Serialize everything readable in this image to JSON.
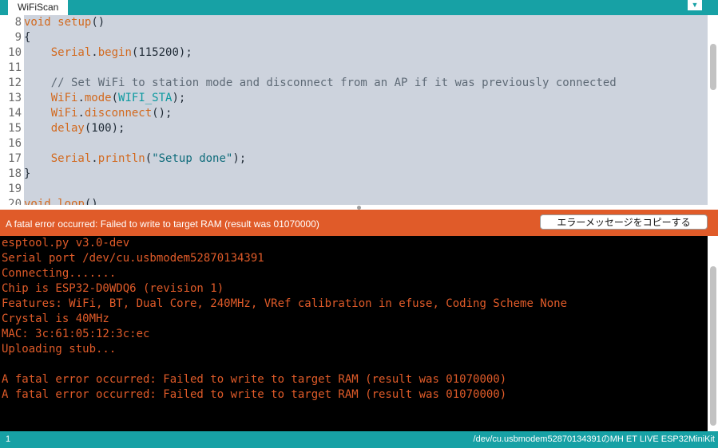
{
  "tabs": [
    {
      "label": "WiFiScan"
    }
  ],
  "tab_menu_icon": "dropdown-arrow-icon",
  "editor": {
    "lines": [
      {
        "num": "8",
        "segments": [
          {
            "t": "void",
            "c": "kw"
          },
          {
            "t": " "
          },
          {
            "t": "setup",
            "c": "fn"
          },
          {
            "t": "()"
          }
        ]
      },
      {
        "num": "9",
        "segments": [
          {
            "t": "{"
          }
        ]
      },
      {
        "num": "10",
        "segments": [
          {
            "t": "    "
          },
          {
            "t": "Serial",
            "c": "kw"
          },
          {
            "t": "."
          },
          {
            "t": "begin",
            "c": "fn"
          },
          {
            "t": "(115200);"
          }
        ]
      },
      {
        "num": "11",
        "segments": [
          {
            "t": ""
          }
        ]
      },
      {
        "num": "12",
        "segments": [
          {
            "t": "    // Set WiFi to station mode and disconnect from an AP if it was previously connected",
            "c": "cmt"
          }
        ]
      },
      {
        "num": "13",
        "segments": [
          {
            "t": "    "
          },
          {
            "t": "WiFi",
            "c": "kw"
          },
          {
            "t": "."
          },
          {
            "t": "mode",
            "c": "fn"
          },
          {
            "t": "("
          },
          {
            "t": "WIFI_STA",
            "c": "const"
          },
          {
            "t": ");"
          }
        ]
      },
      {
        "num": "14",
        "segments": [
          {
            "t": "    "
          },
          {
            "t": "WiFi",
            "c": "kw"
          },
          {
            "t": "."
          },
          {
            "t": "disconnect",
            "c": "fn"
          },
          {
            "t": "();"
          }
        ]
      },
      {
        "num": "15",
        "segments": [
          {
            "t": "    "
          },
          {
            "t": "delay",
            "c": "fn"
          },
          {
            "t": "(100);"
          }
        ]
      },
      {
        "num": "16",
        "segments": [
          {
            "t": ""
          }
        ]
      },
      {
        "num": "17",
        "segments": [
          {
            "t": "    "
          },
          {
            "t": "Serial",
            "c": "kw"
          },
          {
            "t": "."
          },
          {
            "t": "println",
            "c": "fn"
          },
          {
            "t": "("
          },
          {
            "t": "\"Setup done\"",
            "c": "str"
          },
          {
            "t": ");"
          }
        ]
      },
      {
        "num": "18",
        "segments": [
          {
            "t": "}"
          }
        ]
      },
      {
        "num": "19",
        "segments": [
          {
            "t": ""
          }
        ]
      },
      {
        "num": "20",
        "segments": [
          {
            "t": "void",
            "c": "kw"
          },
          {
            "t": " "
          },
          {
            "t": "loop",
            "c": "fn"
          },
          {
            "t": "()"
          }
        ]
      }
    ]
  },
  "error_bar": {
    "message": "A fatal error occurred: Failed to write to target RAM (result was 01070000)",
    "copy_button_label": "エラーメッセージをコピーする"
  },
  "console": {
    "lines": [
      "esptool.py v3.0-dev",
      "Serial port /dev/cu.usbmodem52870134391",
      "Connecting.......",
      "Chip is ESP32-D0WDQ6 (revision 1)",
      "Features: WiFi, BT, Dual Core, 240MHz, VRef calibration in efuse, Coding Scheme None",
      "Crystal is 40MHz",
      "MAC: 3c:61:05:12:3c:ec",
      "Uploading stub...",
      "",
      "A fatal error occurred: Failed to write to target RAM (result was 01070000)",
      "A fatal error occurred: Failed to write to target RAM (result was 01070000)"
    ]
  },
  "statusbar": {
    "line_number": "1",
    "board_info": "/dev/cu.usbmodem52870134391のMH ET LIVE ESP32MiniKit"
  },
  "colors": {
    "accent": "#17a1a5",
    "error": "#e05b29",
    "console_bg": "#000000",
    "editor_bg": "#cdd3dd"
  }
}
